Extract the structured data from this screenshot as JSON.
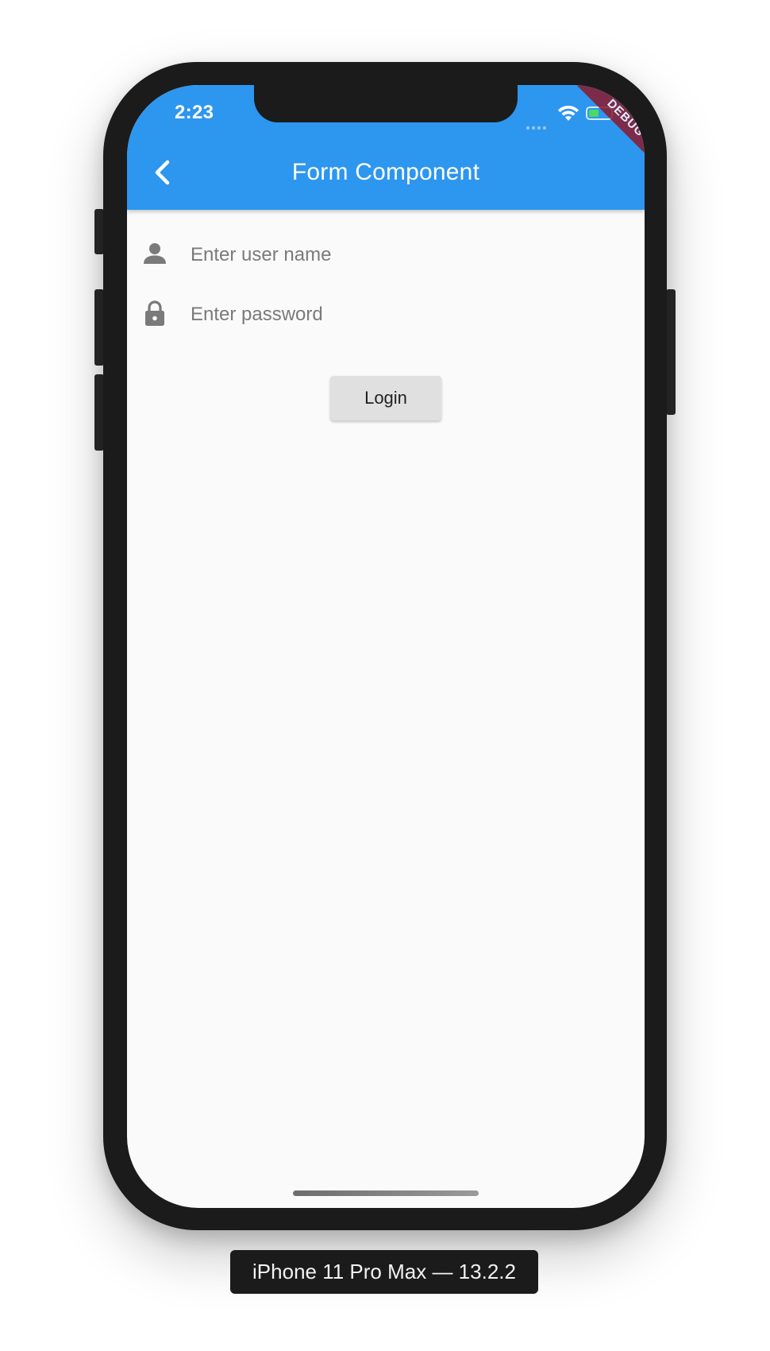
{
  "status_bar": {
    "time": "2:23"
  },
  "debug_banner": "DEBUG",
  "app_bar": {
    "title": "Form Component",
    "back_icon": "chevron-left-icon"
  },
  "form": {
    "username": {
      "icon": "person-icon",
      "placeholder": "Enter user name",
      "value": ""
    },
    "password": {
      "icon": "lock-icon",
      "placeholder": "Enter password",
      "value": ""
    },
    "login_label": "Login"
  },
  "device_label": "iPhone 11 Pro Max — 13.2.2",
  "colors": {
    "app_bar": "#2d96ef",
    "background": "#fafafa",
    "button": "#e0e0e0",
    "icon": "#7a7a7a"
  }
}
